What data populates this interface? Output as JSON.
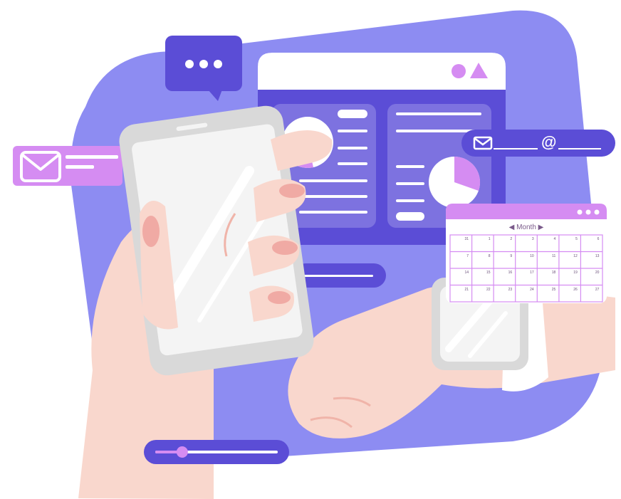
{
  "calendar": {
    "title": "Month",
    "prev_icon": "chevron-left-icon",
    "next_icon": "chevron-right-icon",
    "rows": [
      [
        "31",
        "1",
        "2",
        "3",
        "4",
        "5",
        "6"
      ],
      [
        "7",
        "8",
        "9",
        "10",
        "11",
        "12",
        "13"
      ],
      [
        "14",
        "15",
        "16",
        "17",
        "18",
        "19",
        "20"
      ],
      [
        "21",
        "22",
        "23",
        "24",
        "25",
        "26",
        "27"
      ]
    ]
  },
  "email_card": {
    "at_symbol": "@"
  },
  "slider": {
    "level": 0.22
  },
  "colors": {
    "blob": "#8d8cf2",
    "indigo": "#5b4dd6",
    "magenta": "#d58cf2",
    "skin": "#f9d7cd",
    "nail": "#f0aaa4",
    "device": "#d9d9d9"
  }
}
